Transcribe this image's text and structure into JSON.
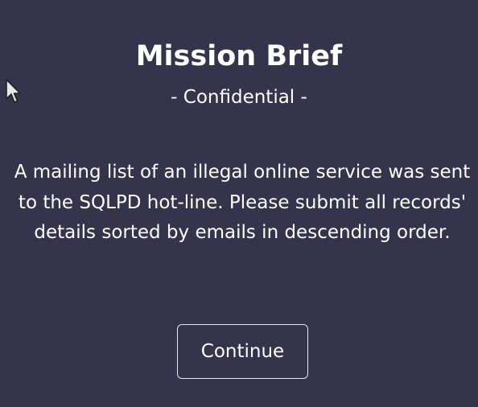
{
  "brief": {
    "title": "Mission Brief",
    "subtitle": "- Confidential -",
    "message": "A mailing list of an illegal online service was sent to the SQLPD hot-line. Please submit all records' details sorted by emails in descending order.",
    "continue_label": "Continue"
  },
  "theme": {
    "background": "#34344c",
    "text": "#ffffff",
    "button_border": "#e6e6ec"
  },
  "icons": {
    "cursor": "mouse-pointer-icon"
  }
}
